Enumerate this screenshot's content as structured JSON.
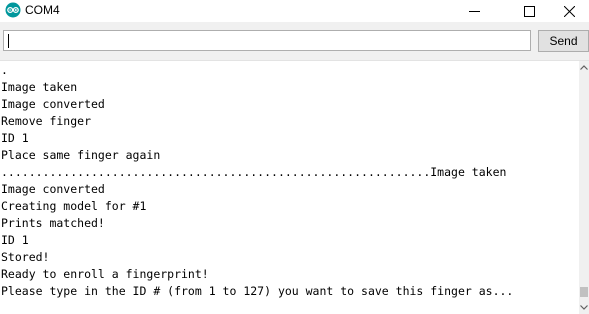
{
  "window": {
    "title": "COM4",
    "icon": "arduino-logo-icon",
    "controls": [
      "minimize-icon",
      "maximize-icon",
      "close-icon"
    ]
  },
  "input": {
    "value": ""
  },
  "send_label": "Send",
  "serial_output": [
    ".",
    "Image taken",
    "Image converted",
    "Remove finger",
    "ID 1",
    "Place same finger again",
    "..............................................................Image taken",
    "Image converted",
    "Creating model for #1",
    "Prints matched!",
    "ID 1",
    "Stored!",
    "Ready to enroll a fingerprint!",
    "Please type in the ID # (from 1 to 127) you want to save this finger as..."
  ],
  "colors": {
    "accent": "#00979c",
    "panel_bg": "#f0f0f0",
    "output_bg": "#ffffff",
    "button_bg": "#e1e1e1"
  }
}
